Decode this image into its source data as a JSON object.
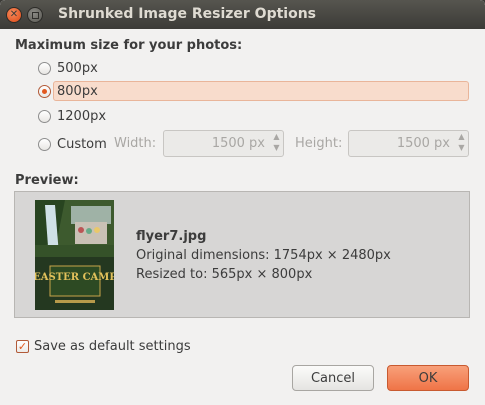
{
  "window": {
    "title": "Shrunked Image Resizer Options"
  },
  "size_section": {
    "heading": "Maximum size for your photos:",
    "options": [
      {
        "label": "500px",
        "selected": false
      },
      {
        "label": "800px",
        "selected": true
      },
      {
        "label": "1200px",
        "selected": false
      },
      {
        "label": "Custom",
        "selected": false
      }
    ],
    "custom": {
      "width_label": "Width:",
      "width_value": "1500 px",
      "height_label": "Height:",
      "height_value": "1500 px"
    }
  },
  "preview": {
    "heading": "Preview:",
    "file_name": "flyer7.jpg",
    "original_dimensions": "Original dimensions: 1754px × 2480px",
    "resized_to": "Resized to: 565px × 800px",
    "thumbnail_text": "EASTER CAMP"
  },
  "default_settings": {
    "label": "Save as default settings",
    "checked": true
  },
  "buttons": {
    "cancel": "Cancel",
    "ok": "OK"
  },
  "colors": {
    "accent": "#e2581f",
    "selection_bg": "#f8dccc",
    "ok_button": "#f28a5d",
    "titlebar": "#3c3b37"
  }
}
